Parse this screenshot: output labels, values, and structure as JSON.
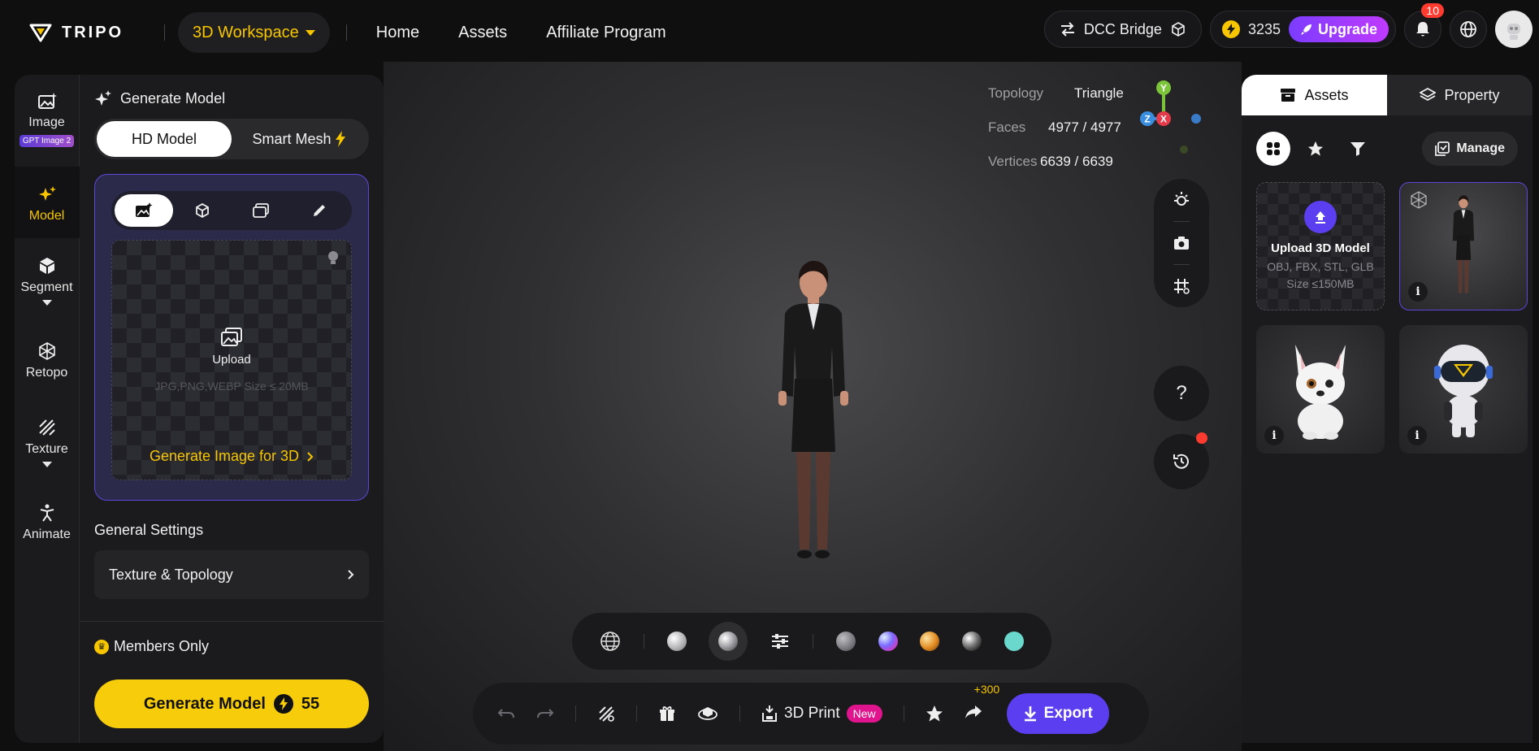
{
  "brand": {
    "name": "TRIPO"
  },
  "nav": {
    "workspace_label": "3D Workspace",
    "links": [
      "Home",
      "Assets",
      "Affiliate Program"
    ]
  },
  "top_right": {
    "dcc_bridge_label": "DCC Bridge",
    "credits": "3235",
    "upgrade_label": "Upgrade",
    "notification_count": "10"
  },
  "left_rail": {
    "items": [
      {
        "label": "Image",
        "badge": "GPT Image 2",
        "icon": "image-sparkle-icon"
      },
      {
        "label": "Model",
        "icon": "sparkle-icon",
        "active": true
      },
      {
        "label": "Segment",
        "icon": "cube-segment-icon"
      },
      {
        "label": "Retopo",
        "icon": "mesh-icon"
      },
      {
        "label": "Texture",
        "icon": "texture-icon"
      },
      {
        "label": "Animate",
        "icon": "figure-icon"
      }
    ]
  },
  "generate": {
    "title": "Generate Model",
    "mode_hd": "HD Model",
    "mode_smart": "Smart Mesh",
    "upload_label": "Upload",
    "upload_hint": "JPG,PNG,WEBP Size ≤ 20MB",
    "gen_image_link": "Generate Image for 3D",
    "general_settings": "General Settings",
    "texture_topology": "Texture & Topology",
    "members_only": "Members Only",
    "button_label": "Generate Model",
    "button_cost": "55"
  },
  "viewport": {
    "stats": {
      "topology_label": "Topology",
      "topology_value": "Triangle",
      "faces_label": "Faces",
      "faces_value": "4977 / 4977",
      "vertices_label": "Vertices",
      "vertices_value": "6639 / 6639"
    },
    "gizmo": {
      "y": "Y",
      "z": "Z",
      "x": "X"
    },
    "print_label": "3D Print",
    "new_badge": "New",
    "share_bonus": "+300",
    "export_label": "Export"
  },
  "right_panel": {
    "tab_assets": "Assets",
    "tab_property": "Property",
    "manage_label": "Manage",
    "upload_title": "Upload 3D Model",
    "upload_formats": "OBJ, FBX, STL, GLB",
    "upload_size": "Size ≤150MB",
    "info_glyph": "i"
  },
  "colors": {
    "accent_yellow": "#f7c600",
    "accent_purple": "#5b3ef0",
    "upgrade_gradient": [
      "#7b3cff",
      "#c03aff"
    ],
    "new_badge": "#e0148c"
  }
}
